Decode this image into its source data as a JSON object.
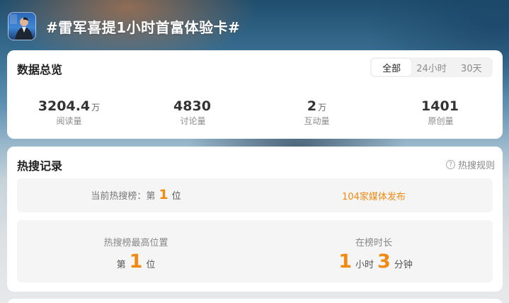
{
  "header": {
    "title": "#雷军喜提1小时首富体验卡#"
  },
  "overview": {
    "title": "数据总览",
    "tabs": [
      {
        "label": "全部",
        "active": true
      },
      {
        "label": "24小时",
        "active": false
      },
      {
        "label": "30天",
        "active": false
      }
    ],
    "stats": [
      {
        "value": "3204.4",
        "unit": "万",
        "label": "阅读量"
      },
      {
        "value": "4830",
        "unit": "",
        "label": "讨论量"
      },
      {
        "value": "2",
        "unit": "万",
        "label": "互动量"
      },
      {
        "value": "1401",
        "unit": "",
        "label": "原创量"
      }
    ]
  },
  "hot": {
    "title": "热搜记录",
    "rules_label": "热搜规则",
    "current_rank": {
      "prefix": "当前热搜榜：第",
      "value": "1",
      "suffix": "位"
    },
    "media_link": "104家媒体发布",
    "highest": {
      "label": "热搜榜最高位置",
      "prefix": "第",
      "value": "1",
      "suffix": "位"
    },
    "duration": {
      "label": "在榜时长",
      "hours": "1",
      "hours_unit": "小时",
      "minutes": "3",
      "minutes_unit": "分钟"
    }
  },
  "colors": {
    "accent": "#f08a12",
    "card": "#ffffff",
    "panel": "#f5f5f5"
  }
}
